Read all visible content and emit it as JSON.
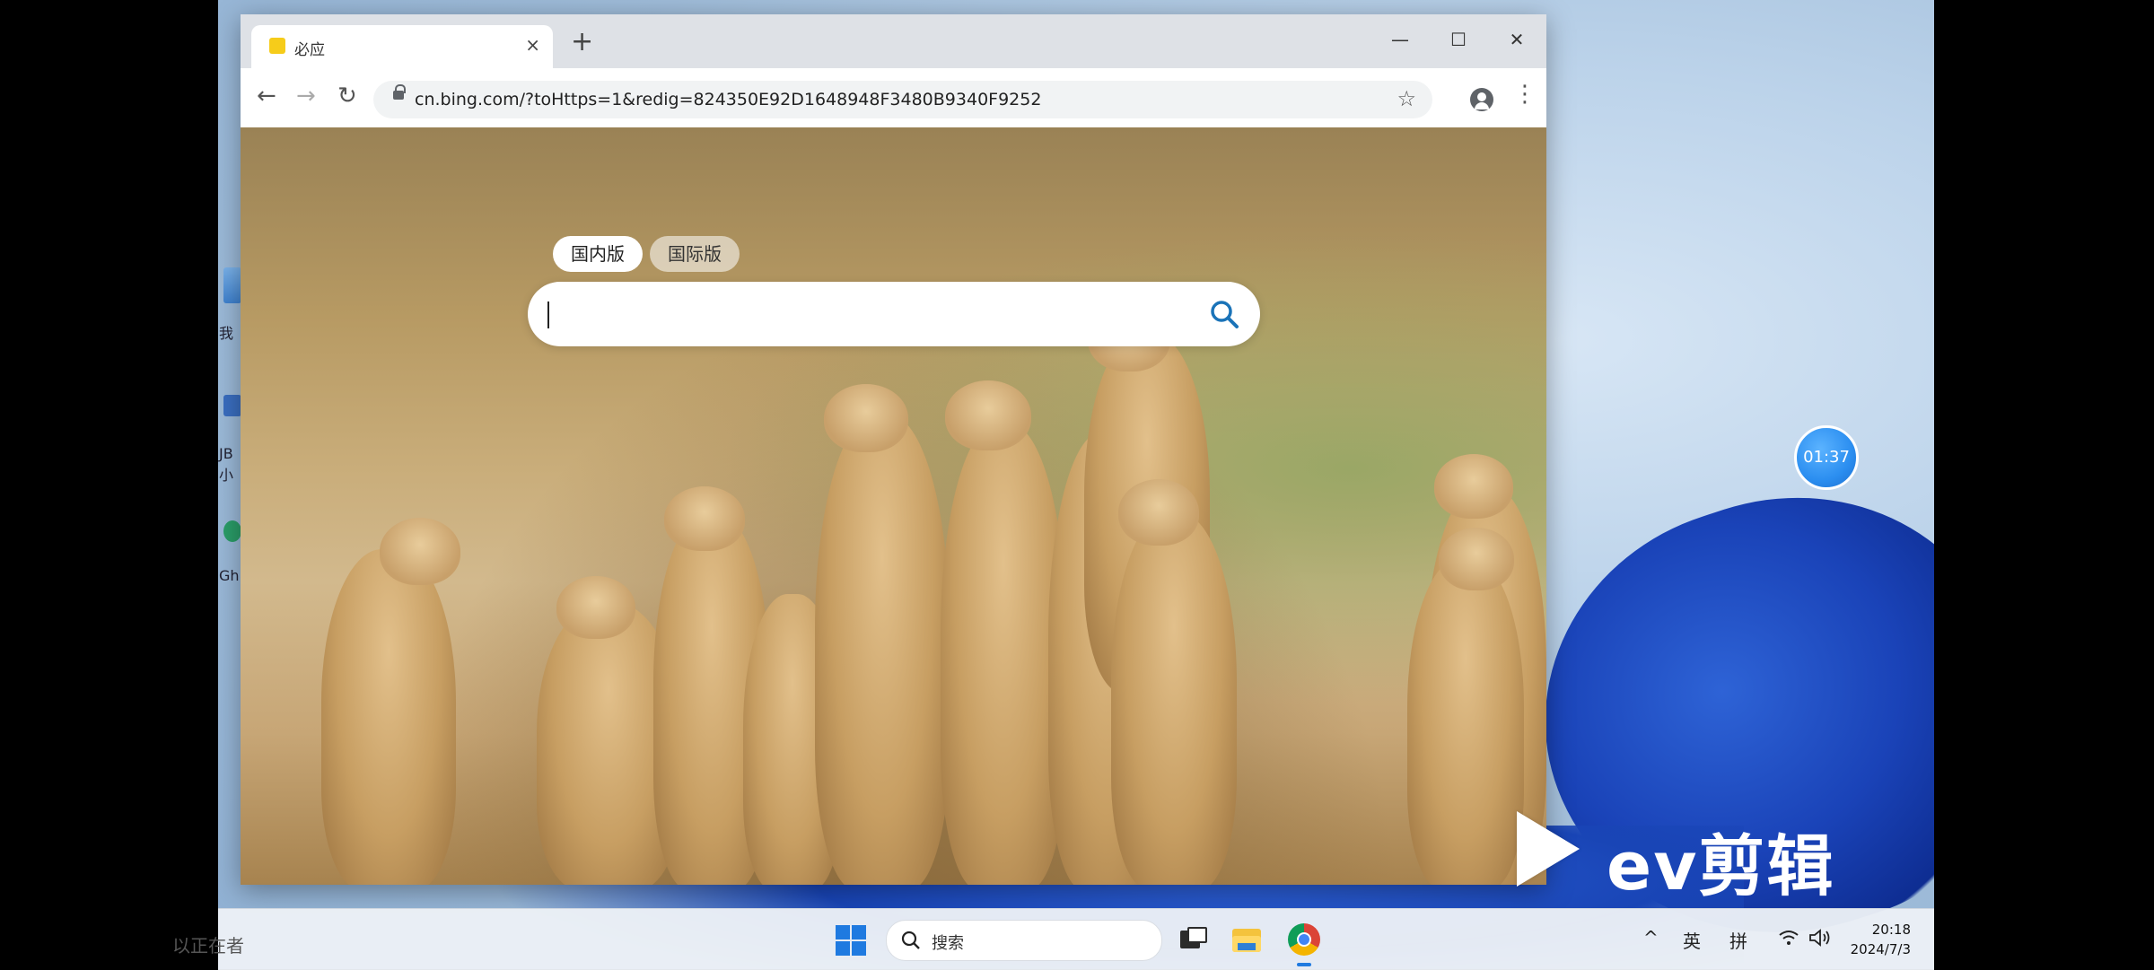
{
  "browser": {
    "tab_title": "必应",
    "tab_close": "×",
    "new_tab": "+",
    "url": "cn.bing.com/?toHttps=1&redig=824350E92D1648948F3480B9340F9252",
    "controls": {
      "minimize": "—",
      "maximize": "☐",
      "close": "✕"
    },
    "nav": {
      "back": "←",
      "forward": "→",
      "reload": "↻",
      "bookmark": "☆",
      "menu": "⋮"
    }
  },
  "bing": {
    "market_tabs": [
      {
        "label": "国内版",
        "active": true
      },
      {
        "label": "国际版",
        "active": false
      }
    ],
    "search_placeholder": ""
  },
  "desktop": {
    "icon_labels": [
      "我",
      "JB",
      "小",
      "Gh"
    ]
  },
  "overlay": {
    "timer": "01:37",
    "watermark": "ev剪辑",
    "recording_status": "以正在者"
  },
  "taskbar": {
    "search_label": "搜索",
    "tray": {
      "chevron": "^",
      "lang": "英",
      "ime": "拼"
    },
    "time": "20:18",
    "date": "2024/7/3"
  },
  "colors": {
    "accent": "#1f7ae0",
    "bing_search_icon": "#1a73b8"
  }
}
